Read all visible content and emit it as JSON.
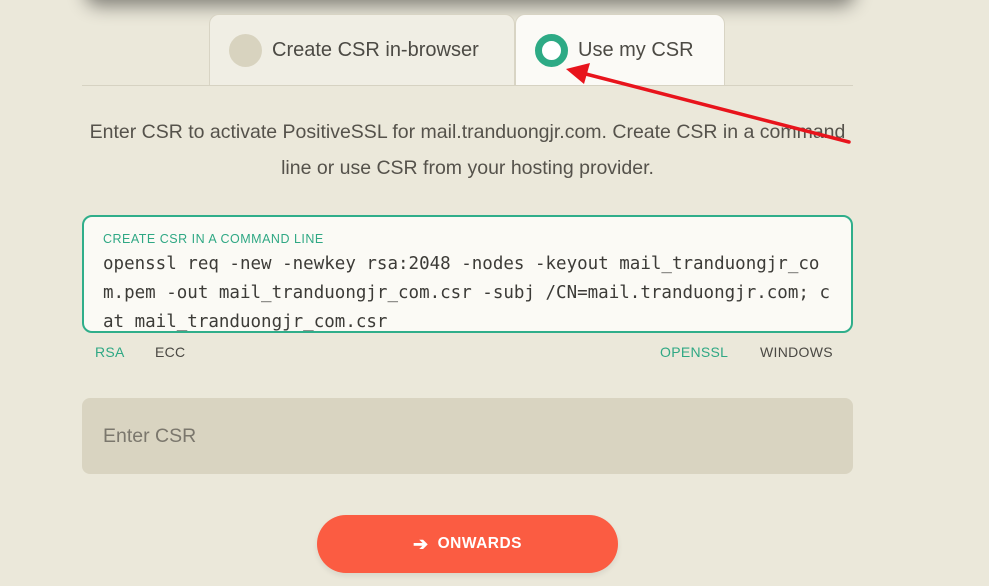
{
  "tabs": [
    {
      "label": "Create CSR in-browser",
      "selected": false
    },
    {
      "label": "Use my CSR",
      "selected": true
    }
  ],
  "intro_text": "Enter CSR to activate PositiveSSL for mail.tranduongjr.com. Create CSR in a command line or use CSR from your hosting provider.",
  "command": {
    "label": "CREATE CSR IN A COMMAND LINE",
    "text": "openssl req -new -newkey rsa:2048 -nodes -keyout mail_tranduongjr_com.pem -out mail_tranduongjr_com.csr -subj /CN=mail.tranduongjr.com; cat mail_tranduongjr_com.csr"
  },
  "key_options": [
    {
      "label": "RSA",
      "active": true
    },
    {
      "label": "ECC",
      "active": false
    }
  ],
  "tool_options": [
    {
      "label": "OPENSSL",
      "active": true
    },
    {
      "label": "WINDOWS",
      "active": false
    }
  ],
  "csr_input": {
    "placeholder": "Enter CSR",
    "value": ""
  },
  "submit": {
    "label": "ONWARDS",
    "icon": "arrow-right-icon"
  },
  "colors": {
    "background": "#ebe8da",
    "accent": "#2fae8a",
    "button": "#fb5c42",
    "annotation_arrow": "#e8141c"
  }
}
